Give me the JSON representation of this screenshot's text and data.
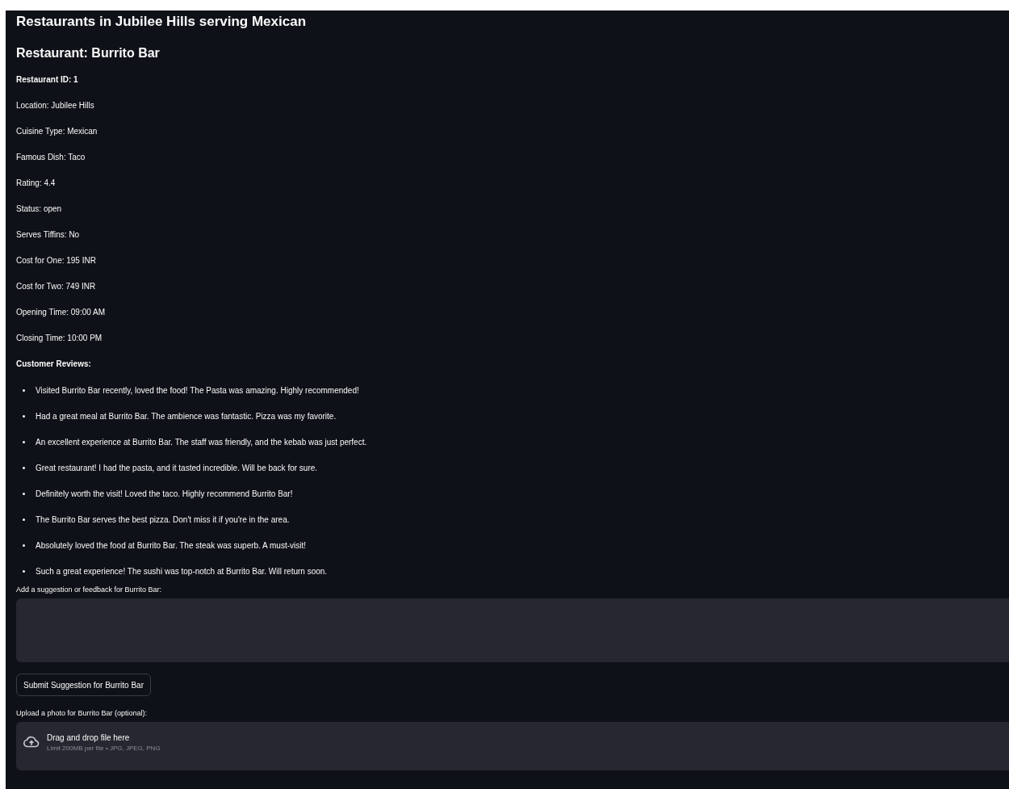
{
  "title": "Restaurants in Jubilee Hills serving Mexican",
  "restaurant_heading": "Restaurant: Burrito Bar",
  "details": [
    {
      "kind": "strong",
      "text": "Restaurant ID: 1"
    },
    {
      "kind": "plain",
      "text": "Location: Jubilee Hills"
    },
    {
      "kind": "plain",
      "text": "Cuisine Type: Mexican"
    },
    {
      "kind": "plain",
      "text": "Famous Dish: Taco"
    },
    {
      "kind": "plain",
      "text": "Rating: 4.4"
    },
    {
      "kind": "plain",
      "text": "Status: open"
    },
    {
      "kind": "plain",
      "text": "Serves Tiffins: No"
    },
    {
      "kind": "plain",
      "text": "Cost for One: 195 INR"
    },
    {
      "kind": "plain",
      "text": "Cost for Two: 749 INR"
    },
    {
      "kind": "plain",
      "text": "Opening Time: 09:00 AM"
    },
    {
      "kind": "plain",
      "text": "Closing Time: 10:00 PM"
    },
    {
      "kind": "strong",
      "text": "Customer Reviews:"
    }
  ],
  "reviews": [
    "Visited Burrito Bar recently, loved the food! The Pasta was amazing. Highly recommended!",
    "Had a great meal at Burrito Bar. The ambience was fantastic. Pizza was my favorite.",
    "An excellent experience at Burrito Bar. The staff was friendly, and the kebab was just perfect.",
    "Great restaurant! I had the pasta, and it tasted incredible. Will be back for sure.",
    "Definitely worth the visit! Loved the taco. Highly recommend Burrito Bar!",
    "The Burrito Bar serves the best pizza. Don't miss it if you're in the area.",
    "Absolutely loved the food at Burrito Bar. The steak was superb. A must-visit!",
    "Such a great experience! The sushi was top-notch at Burrito Bar. Will return soon."
  ],
  "feedback": {
    "label": "Add a suggestion or feedback for Burrito Bar:"
  },
  "submit_button": "Submit Suggestion for Burrito Bar",
  "upload": {
    "label": "Upload a photo for Burrito Bar (optional):",
    "prompt": "Drag and drop file here",
    "limit": "Limit 200MB per file • JPG, JPEG, PNG"
  }
}
